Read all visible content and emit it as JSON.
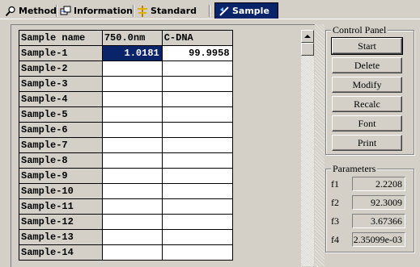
{
  "tabs": [
    {
      "label": "Method",
      "icon": "magnifier-icon",
      "active": false
    },
    {
      "label": "Information",
      "icon": "information-icon",
      "active": false
    },
    {
      "label": "Standard",
      "icon": "standard-icon",
      "active": false
    },
    {
      "label": "Sample",
      "icon": "sample-icon",
      "active": true
    }
  ],
  "grid": {
    "headers": [
      "Sample name",
      "750.0nm",
      "C-DNA"
    ],
    "rows": [
      {
        "name": "Sample-1",
        "v1": "1.0181",
        "v2": "99.9958"
      },
      {
        "name": "Sample-2",
        "v1": "",
        "v2": ""
      },
      {
        "name": "Sample-3",
        "v1": "",
        "v2": ""
      },
      {
        "name": "Sample-4",
        "v1": "",
        "v2": ""
      },
      {
        "name": "Sample-5",
        "v1": "",
        "v2": ""
      },
      {
        "name": "Sample-6",
        "v1": "",
        "v2": ""
      },
      {
        "name": "Sample-7",
        "v1": "",
        "v2": ""
      },
      {
        "name": "Sample-8",
        "v1": "",
        "v2": ""
      },
      {
        "name": "Sample-9",
        "v1": "",
        "v2": ""
      },
      {
        "name": "Sample-10",
        "v1": "",
        "v2": ""
      },
      {
        "name": "Sample-11",
        "v1": "",
        "v2": ""
      },
      {
        "name": "Sample-12",
        "v1": "",
        "v2": ""
      },
      {
        "name": "Sample-13",
        "v1": "",
        "v2": ""
      },
      {
        "name": "Sample-14",
        "v1": "",
        "v2": ""
      }
    ]
  },
  "control_panel": {
    "title": "Control Panel",
    "buttons": [
      "Start",
      "Delete",
      "Modify",
      "Recalc",
      "Font",
      "Print"
    ]
  },
  "parameters": {
    "title": "Parameters",
    "items": [
      {
        "label": "f1",
        "value": "2.2208"
      },
      {
        "label": "f2",
        "value": "92.3009"
      },
      {
        "label": "f3",
        "value": "3.67366"
      },
      {
        "label": "f4",
        "value": "2.35099e-03"
      }
    ]
  },
  "colors": {
    "face": "#d4d0c8",
    "selection": "#0a246a"
  }
}
